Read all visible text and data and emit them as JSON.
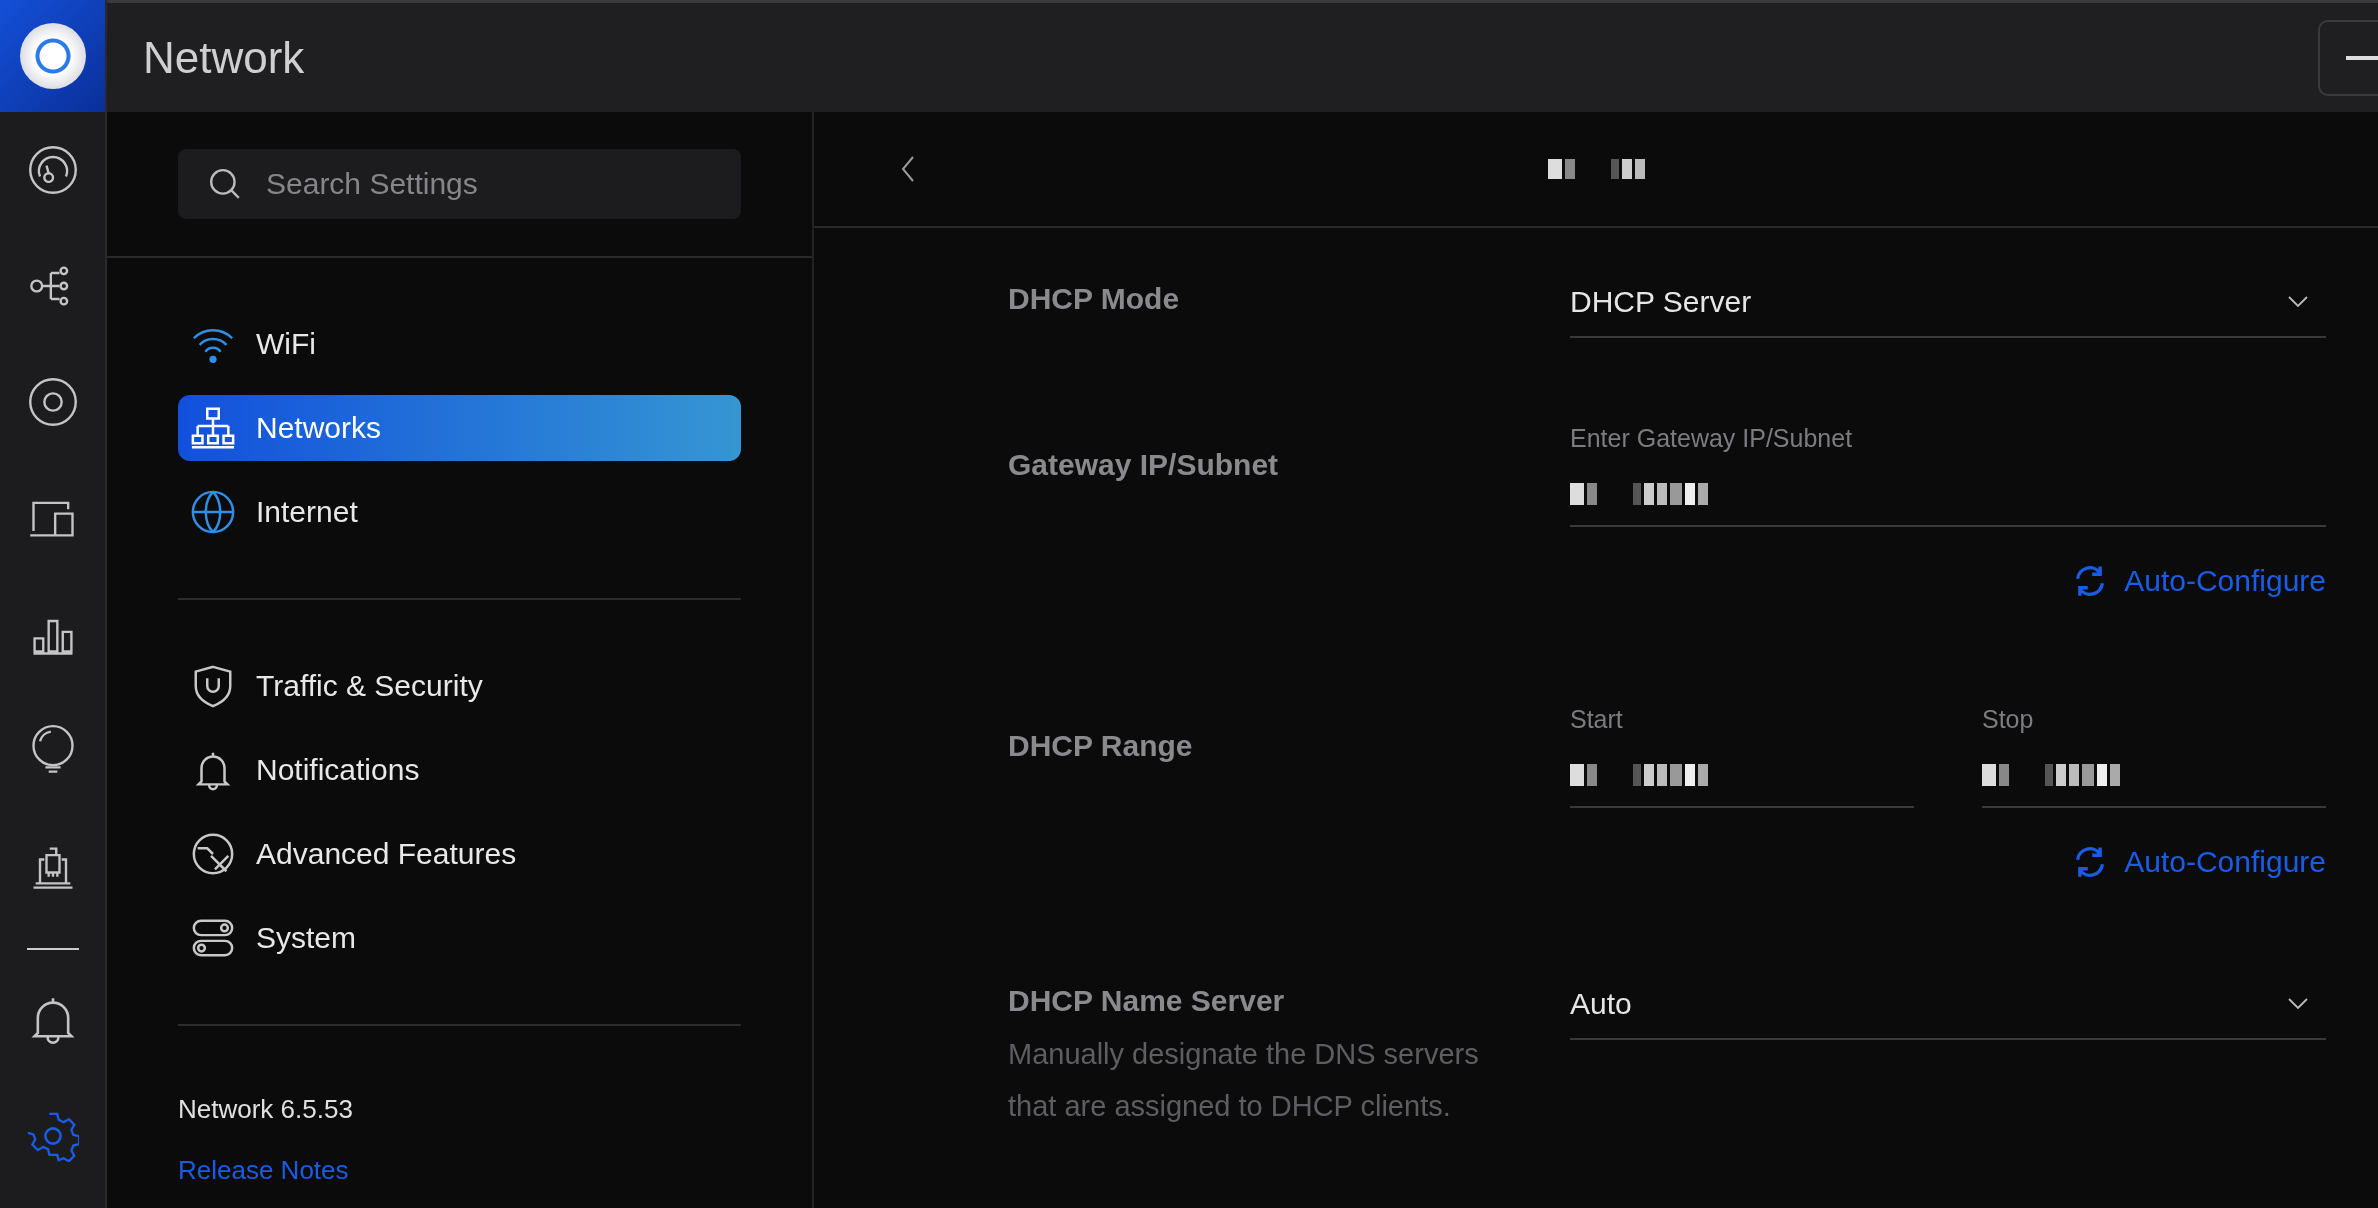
{
  "app": {
    "title": "Network"
  },
  "rail": [
    {
      "kind": "dashboard",
      "selected": false
    },
    {
      "kind": "topology",
      "selected": false
    },
    {
      "kind": "devices",
      "selected": false
    },
    {
      "kind": "clients",
      "selected": false
    },
    {
      "kind": "statistics",
      "selected": false
    },
    {
      "kind": "insights",
      "selected": false
    },
    {
      "kind": "traffic",
      "selected": false
    }
  ],
  "rail_bottom": [
    {
      "kind": "alerts",
      "selected": false
    },
    {
      "kind": "settings",
      "selected": true
    }
  ],
  "search": {
    "placeholder": "Search Settings"
  },
  "nav_groups": [
    [
      {
        "kind": "wifi",
        "label": "WiFi",
        "selected": false
      },
      {
        "kind": "networks",
        "label": "Networks",
        "selected": true
      },
      {
        "kind": "internet",
        "label": "Internet",
        "selected": false
      }
    ],
    [
      {
        "kind": "security",
        "label": "Traffic & Security",
        "selected": false
      },
      {
        "kind": "notifications",
        "label": "Notifications",
        "selected": false
      },
      {
        "kind": "advanced",
        "label": "Advanced Features",
        "selected": false
      },
      {
        "kind": "system",
        "label": "System",
        "selected": false
      }
    ]
  ],
  "version": "Network 6.5.53",
  "release_notes": "Release Notes",
  "form": {
    "rows": [
      {
        "kind": "select",
        "label": "DHCP Mode",
        "value": "DHCP Server"
      },
      {
        "kind": "field",
        "label": "Gateway IP/Subnet",
        "field_label": "Enter Gateway IP/Subnet",
        "action": "Auto-Configure"
      },
      {
        "kind": "range",
        "label": "DHCP Range",
        "start_label": "Start",
        "stop_label": "Stop",
        "action": "Auto-Configure"
      },
      {
        "kind": "select",
        "label": "DHCP Name Server",
        "value": "Auto",
        "description": "Manually designate the DNS servers that are assigned to DHCP clients."
      }
    ]
  }
}
